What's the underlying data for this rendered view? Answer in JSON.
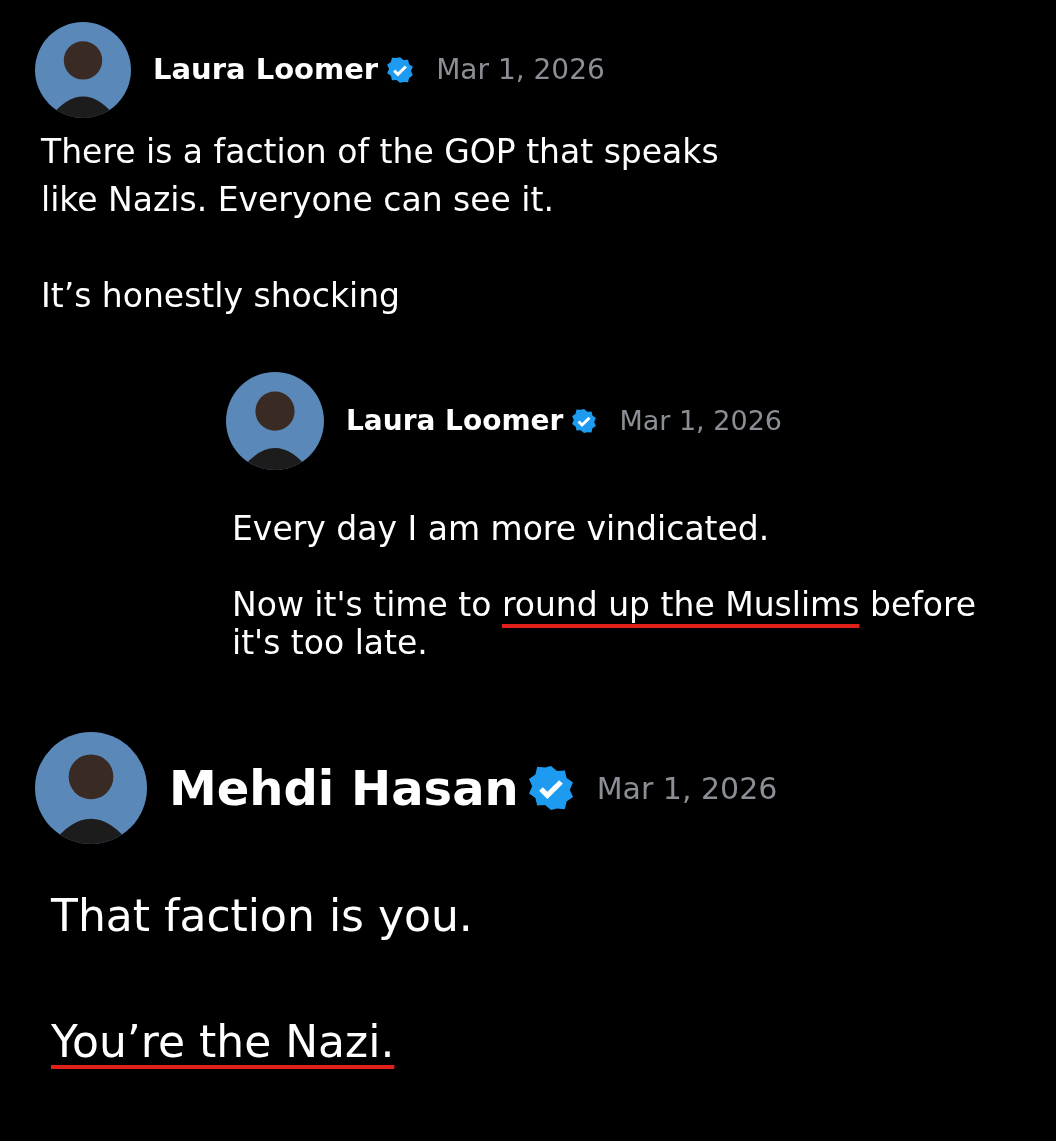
{
  "posts": [
    {
      "author": "Laura Loomer",
      "verified": true,
      "date": "Mar 1, 2026",
      "kind": "post",
      "paragraphs": [
        [
          {
            "text": "There is a faction of the GOP that speaks like Nazis. Everyone can see it.",
            "underlined": false
          }
        ],
        [
          {
            "text": "It’s honestly shocking",
            "underlined": false
          }
        ]
      ]
    },
    {
      "author": "Laura Loomer",
      "verified": true,
      "date": "Mar 1, 2026",
      "kind": "quote",
      "paragraphs": [
        [
          {
            "text": "Every day I am more vindicated.",
            "underlined": false
          }
        ],
        [
          {
            "text": "Now it's time to ",
            "underlined": false
          },
          {
            "text": "round up the Muslims",
            "underlined": true
          },
          {
            "text": " before it's too late.",
            "underlined": false
          }
        ]
      ]
    },
    {
      "author": "Mehdi Hasan",
      "verified": true,
      "date": "Mar 1, 2026",
      "kind": "reply",
      "paragraphs": [
        [
          {
            "text": "That faction is you.",
            "underlined": false
          }
        ],
        [
          {
            "text": "You’re the Nazi.",
            "underlined": true
          }
        ]
      ]
    }
  ]
}
